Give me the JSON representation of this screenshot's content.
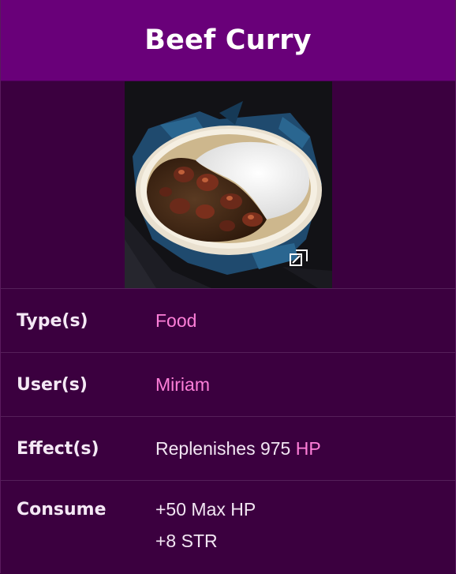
{
  "infobox": {
    "title": "Beef Curry",
    "image_alt": "Beef Curry",
    "expand_icon": "expand-image-icon",
    "rows": {
      "type": {
        "label": "Type(s)",
        "value": "Food"
      },
      "user": {
        "label": "User(s)",
        "value": "Miriam"
      },
      "effect": {
        "label": "Effect(s)",
        "value_prefix": "Replenishes 975 ",
        "value_link": "HP"
      },
      "consume": {
        "label": "Consume",
        "line1": "+50 Max HP",
        "line2": "+8 STR"
      }
    }
  },
  "colors": {
    "header_bg": "#690079",
    "body_bg": "#3b003f",
    "link": "#ff7fd9",
    "divider": "#55205a"
  }
}
